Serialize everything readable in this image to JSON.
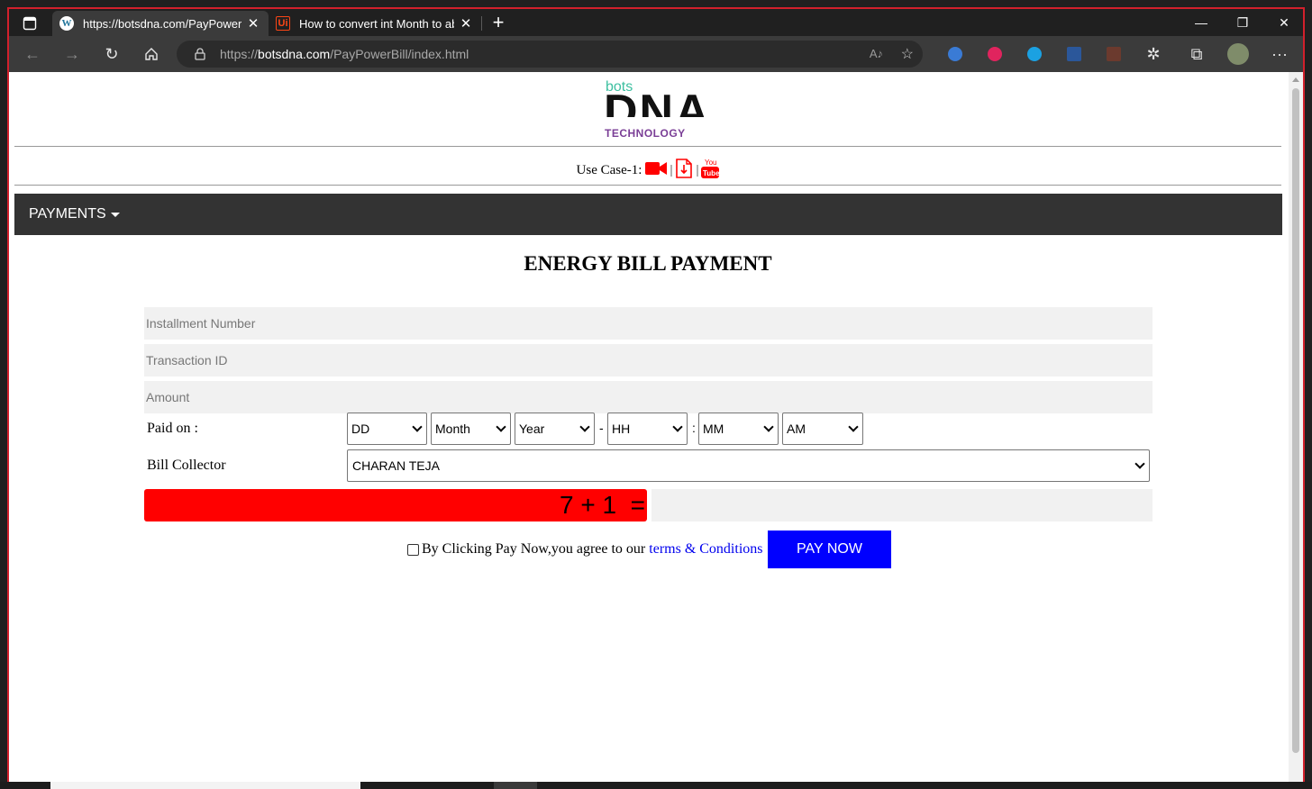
{
  "browser": {
    "tabs": [
      {
        "title": "https://botsdna.com/PayPowerBill",
        "favicon": "wordpress-icon",
        "active": true
      },
      {
        "title": "How to convert int Month to abbr",
        "favicon": "uipath-icon",
        "active": false
      }
    ],
    "address": {
      "scheme": "https://",
      "host": "botsdna.com",
      "path": "/PayPowerBill/index.html"
    },
    "accent_border": "#d2202c"
  },
  "site": {
    "logo": {
      "top": "bots",
      "middle": "DNA",
      "bottom": "TECHNOLOGY"
    },
    "usecase_label": "Use Case-1:",
    "nav": {
      "payments": "PAYMENTS"
    }
  },
  "form": {
    "heading": "ENERGY BILL PAYMENT",
    "installment_placeholder": "Installment Number",
    "transaction_placeholder": "Transaction ID",
    "amount_placeholder": "Amount",
    "paid_on_label": "Paid on :",
    "dd": "DD",
    "month": "Month",
    "year": "Year",
    "dash": "-",
    "hh": "HH",
    "colon": ":",
    "mm": "MM",
    "ampm": "AM",
    "bill_collector_label": "Bill Collector",
    "bill_collector_value": "CHARAN TEJA",
    "captcha": "7 + 1  =",
    "agree_text": "By Clicking Pay Now,you agree to our",
    "terms_link": "terms & Conditions",
    "pay_button": "PAY NOW"
  },
  "colors": {
    "captcha_bg": "#ff0000",
    "pay_button": "#0000ff",
    "navbar": "#333333"
  }
}
